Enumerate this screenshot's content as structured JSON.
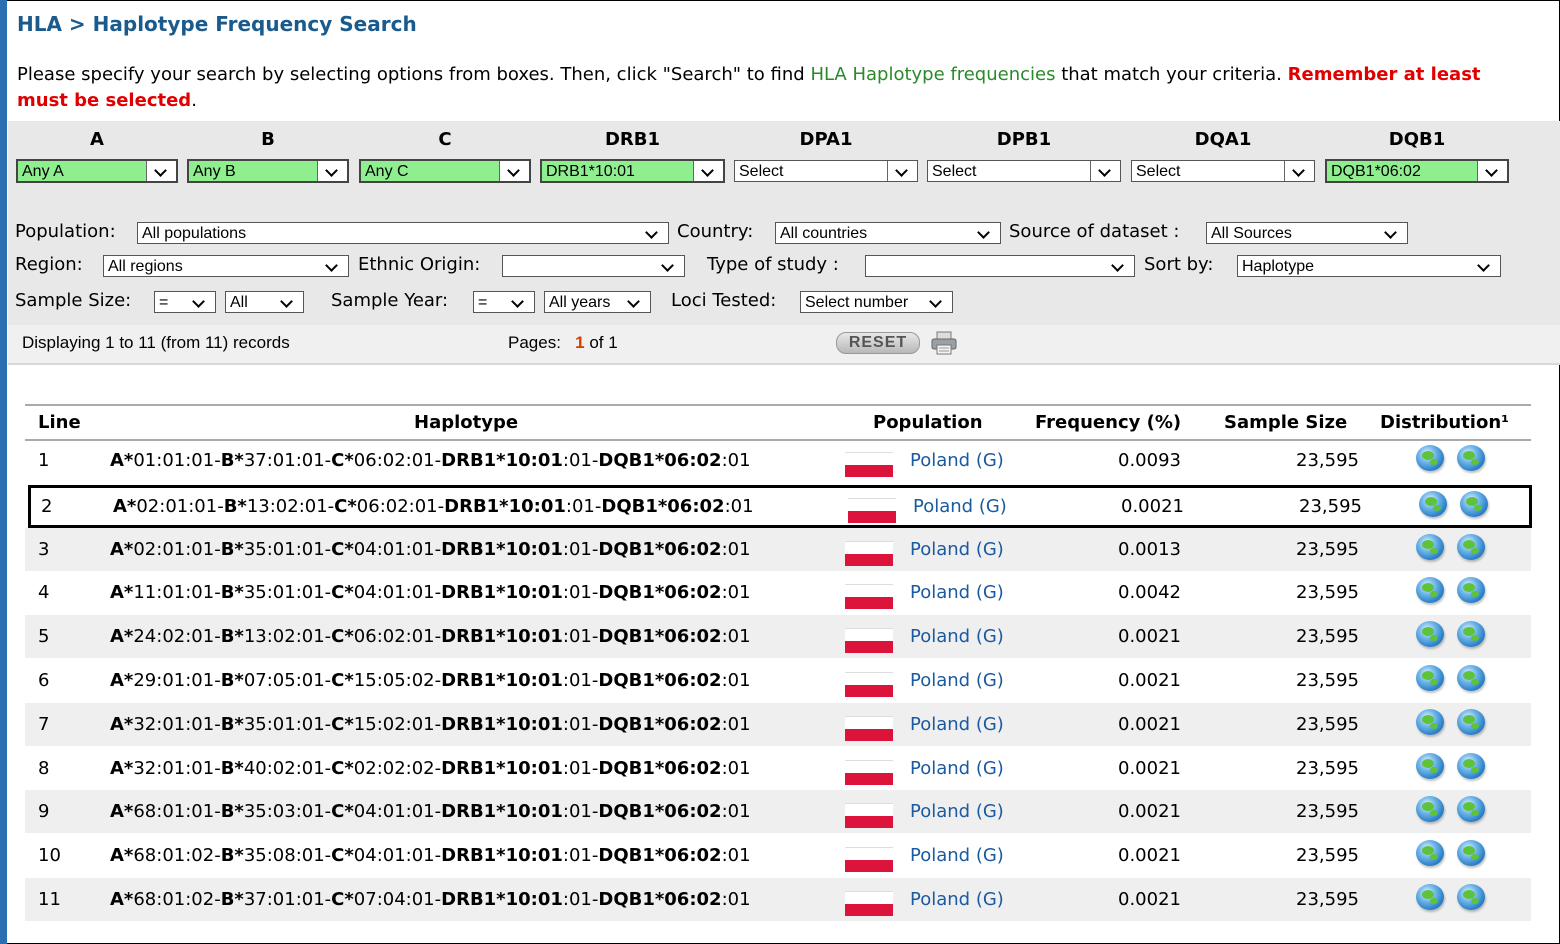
{
  "title": "HLA > Haplotype Frequency Search",
  "intro": {
    "text1": "Please specify your search by selecting options from boxes. Then, click \"Search\" to find ",
    "link": "HLA Haplotype frequencies",
    "text2": " that match your criteria. ",
    "warning1": "Remember at least",
    "warning2": "must be selected",
    "period": "."
  },
  "loci": [
    {
      "label": "A",
      "value": "Any A",
      "selected": true
    },
    {
      "label": "B",
      "value": "Any B",
      "selected": true
    },
    {
      "label": "C",
      "value": "Any C",
      "selected": true
    },
    {
      "label": "DRB1",
      "value": "DRB1*10:01",
      "selected": true
    },
    {
      "label": "DPA1",
      "value": "Select",
      "selected": false
    },
    {
      "label": "DPB1",
      "value": "Select",
      "selected": false
    },
    {
      "label": "DQA1",
      "value": "Select",
      "selected": false
    },
    {
      "label": "DQB1",
      "value": "DQB1*06:02",
      "selected": true
    }
  ],
  "filters": {
    "population_label": "Population:",
    "population_value": "All populations",
    "country_label": "Country:",
    "country_value": "All countries",
    "source_label": "Source of dataset :",
    "source_value": "All Sources",
    "region_label": "Region:",
    "region_value": "All regions",
    "ethnic_label": "Ethnic Origin:",
    "ethnic_value": "",
    "study_label": "Type of study :",
    "study_value": "",
    "sort_label": "Sort by:",
    "sort_value": "Haplotype",
    "sample_size_label": "Sample Size:",
    "sample_size_op": "=",
    "sample_size_value": "All",
    "sample_year_label": "Sample Year:",
    "sample_year_op": "=",
    "sample_year_value": "All years",
    "loci_tested_label": "Loci Tested:",
    "loci_tested_value": "Select number"
  },
  "status": {
    "displaying": "Displaying 1 to 11 (from 11) records",
    "pages_label": "Pages:",
    "pages_current": "1",
    "pages_total": "of 1",
    "reset_label": "RESET"
  },
  "table": {
    "headers": {
      "line": "Line",
      "haplotype": "Haplotype",
      "population": "Population",
      "frequency": "Frequency (%)",
      "sample_size": "Sample Size",
      "distribution": "Distribution¹"
    },
    "rows": [
      {
        "line": "1",
        "a": "01:01:01",
        "b": "37:01:01",
        "c": "06:02:01",
        "drb1_rest": ":01",
        "dqb1_rest": ":01",
        "population": "Poland (G)",
        "frequency": "0.0093",
        "sample_size": "23,595"
      },
      {
        "line": "2",
        "a": "02:01:01",
        "b": "13:02:01",
        "c": "06:02:01",
        "drb1_rest": ":01",
        "dqb1_rest": ":01",
        "population": "Poland (G)",
        "frequency": "0.0021",
        "sample_size": "23,595"
      },
      {
        "line": "3",
        "a": "02:01:01",
        "b": "35:01:01",
        "c": "04:01:01",
        "drb1_rest": ":01",
        "dqb1_rest": ":01",
        "population": "Poland (G)",
        "frequency": "0.0013",
        "sample_size": "23,595"
      },
      {
        "line": "4",
        "a": "11:01:01",
        "b": "35:01:01",
        "c": "04:01:01",
        "drb1_rest": ":01",
        "dqb1_rest": ":01",
        "population": "Poland (G)",
        "frequency": "0.0042",
        "sample_size": "23,595"
      },
      {
        "line": "5",
        "a": "24:02:01",
        "b": "13:02:01",
        "c": "06:02:01",
        "drb1_rest": ":01",
        "dqb1_rest": ":01",
        "population": "Poland (G)",
        "frequency": "0.0021",
        "sample_size": "23,595"
      },
      {
        "line": "6",
        "a": "29:01:01",
        "b": "07:05:01",
        "c": "15:05:02",
        "drb1_rest": ":01",
        "dqb1_rest": ":01",
        "population": "Poland (G)",
        "frequency": "0.0021",
        "sample_size": "23,595"
      },
      {
        "line": "7",
        "a": "32:01:01",
        "b": "35:01:01",
        "c": "15:02:01",
        "drb1_rest": ":01",
        "dqb1_rest": ":01",
        "population": "Poland (G)",
        "frequency": "0.0021",
        "sample_size": "23,595"
      },
      {
        "line": "8",
        "a": "32:01:01",
        "b": "40:02:01",
        "c": "02:02:02",
        "drb1_rest": ":01",
        "dqb1_rest": ":01",
        "population": "Poland (G)",
        "frequency": "0.0021",
        "sample_size": "23,595"
      },
      {
        "line": "9",
        "a": "68:01:01",
        "b": "35:03:01",
        "c": "04:01:01",
        "drb1_rest": ":01",
        "dqb1_rest": ":01",
        "population": "Poland (G)",
        "frequency": "0.0021",
        "sample_size": "23,595"
      },
      {
        "line": "10",
        "a": "68:01:02",
        "b": "35:08:01",
        "c": "04:01:01",
        "drb1_rest": ":01",
        "dqb1_rest": ":01",
        "population": "Poland (G)",
        "frequency": "0.0021",
        "sample_size": "23,595"
      },
      {
        "line": "11",
        "a": "68:01:02",
        "b": "37:01:01",
        "c": "07:04:01",
        "drb1_rest": ":01",
        "dqb1_rest": ":01",
        "population": "Poland (G)",
        "frequency": "0.0021",
        "sample_size": "23,595"
      }
    ]
  },
  "haplotype_parts": {
    "a_prefix": "A*",
    "b_prefix": "B*",
    "c_prefix": "C*",
    "drb1_prefix": "DRB1*10:01",
    "dqb1_prefix": "DQB1*06:02",
    "sep": "-"
  },
  "colors": {
    "title": "#1a5a8c",
    "link_green": "#2a8a2a",
    "warning_red": "#e00000",
    "selected_green": "#8fef8f",
    "population_link": "#1a5aa0"
  },
  "icons": {
    "printer": "printer-icon",
    "distribution": "globe-icon",
    "flag": "poland-flag-icon"
  }
}
